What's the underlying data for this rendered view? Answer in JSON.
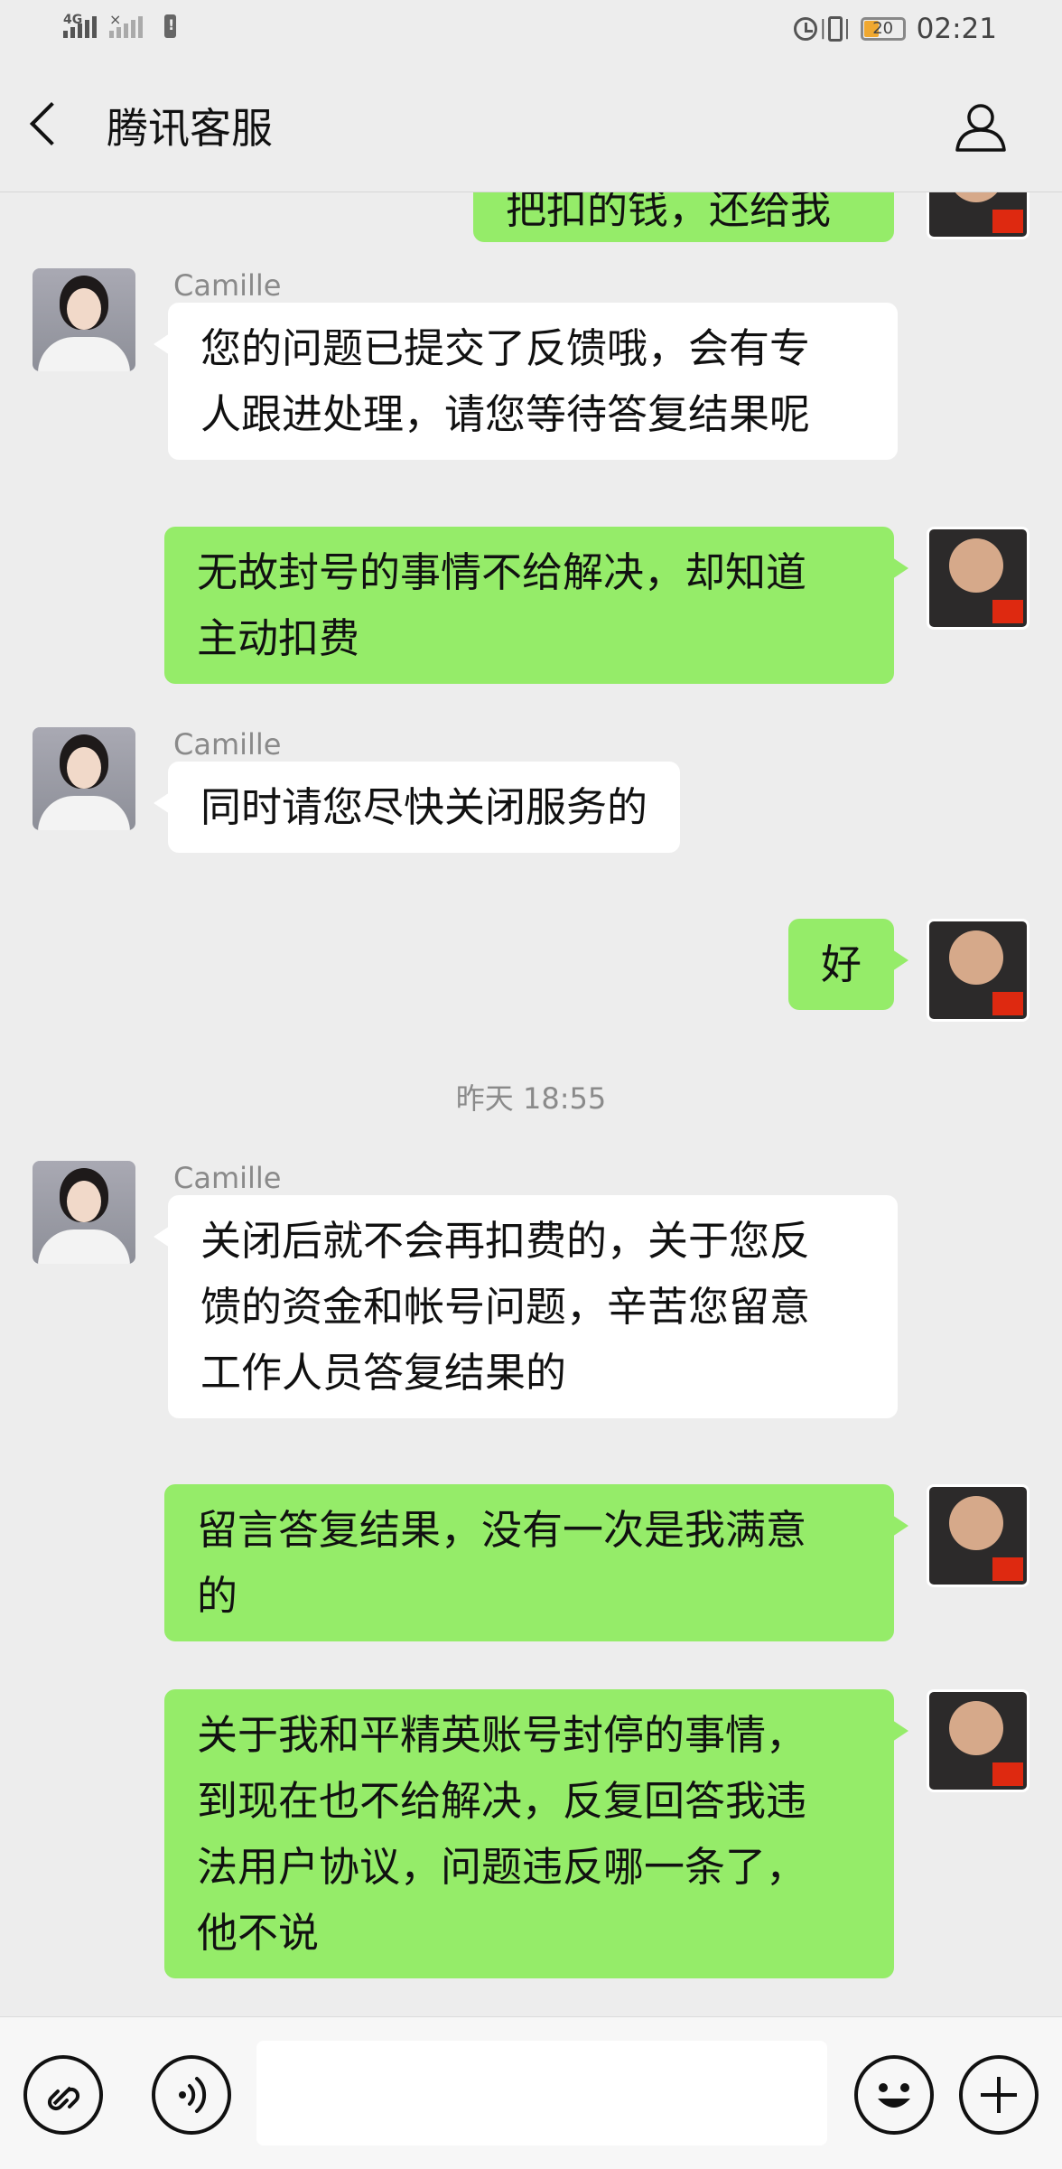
{
  "status_bar": {
    "network_label": "4G",
    "time": "02:21",
    "battery": "20"
  },
  "header": {
    "title": "腾讯客服"
  },
  "messages": [
    {
      "from": "me",
      "lines": [
        "把扣的钱，还给我"
      ]
    },
    {
      "from": "cs",
      "sender": "Camille",
      "lines": [
        "您的问题已提交了反馈哦，会有专",
        "人跟进处理，请您等待答复结果呢"
      ]
    },
    {
      "from": "me",
      "lines": [
        "无故封号的事情不给解决，却知道",
        "主动扣费"
      ]
    },
    {
      "from": "cs",
      "sender": "Camille",
      "lines": [
        "同时请您尽快关闭服务的"
      ]
    },
    {
      "from": "me",
      "lines": [
        "好"
      ]
    },
    {
      "type": "time",
      "text": "昨天 18:55"
    },
    {
      "from": "cs",
      "sender": "Camille",
      "lines": [
        "关闭后就不会再扣费的，关于您反",
        "馈的资金和帐号问题，辛苦您留意",
        "工作人员答复结果的"
      ]
    },
    {
      "from": "me",
      "lines": [
        "留言答复结果，没有一次是我满意",
        "的"
      ]
    },
    {
      "from": "me",
      "lines": [
        "关于我和平精英账号封停的事情，",
        "到现在也不给解决，反复回答我违",
        "法用户协议，问题违反哪一条了，",
        "他不说"
      ]
    }
  ],
  "colors": {
    "background": "#ededed",
    "outgoing_bubble": "#95ec69",
    "incoming_bubble": "#ffffff",
    "meta_text": "#8a8a8a",
    "battery_fill": "#f0a830"
  },
  "icons": {
    "back": "chevron-left-icon",
    "profile": "person-icon",
    "mini_program": "link-icon",
    "voice": "voice-icon",
    "emoji": "emoji-icon",
    "more": "plus-icon"
  }
}
